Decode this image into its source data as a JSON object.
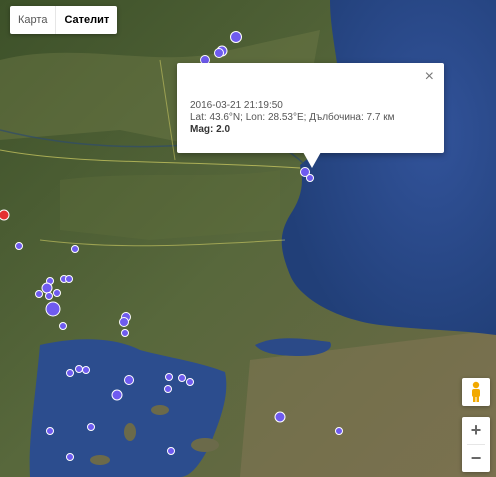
{
  "map": {
    "type_control": {
      "map_label": "Карта",
      "satellite_label": "Сателит",
      "active": "satellite"
    },
    "zoom_in_label": "+",
    "zoom_out_label": "−",
    "info_window": {
      "datetime": "2016-03-21 21:19:50",
      "location": "Lat: 43.6°N; Lon: 28.53°E; Дълбочина: 7.7 км",
      "magnitude": "Mag: 2.0",
      "close_label": "×"
    },
    "colors": {
      "quake": "#6f5bf0",
      "quake_highlight": "#e53030",
      "sea": "#2d4e8c",
      "land": "#4a5b33"
    }
  }
}
